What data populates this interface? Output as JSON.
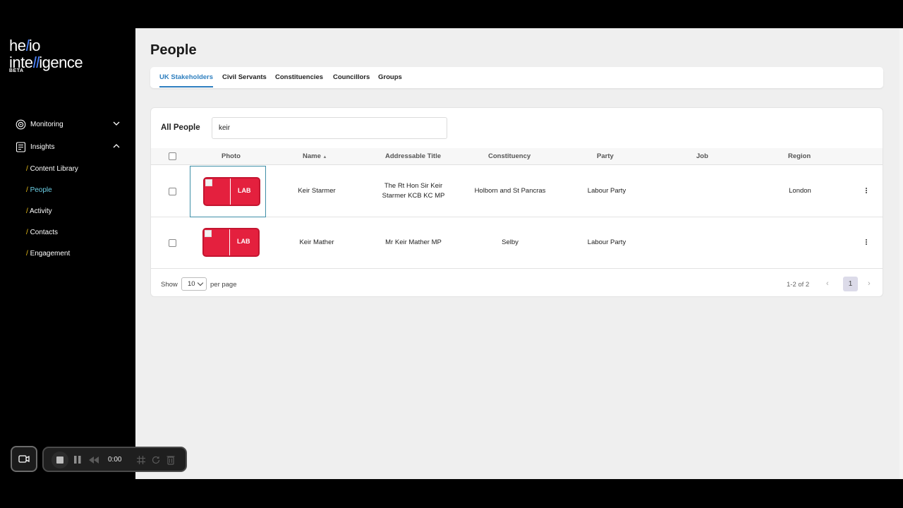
{
  "brand": {
    "line1": "he",
    "line1_accent": "l",
    "line1_end": "io",
    "line2": "inte",
    "line2_accent": "ll",
    "line2_end": "igence",
    "badge": "BETA"
  },
  "sidebar": {
    "groups": [
      {
        "label": "Monitoring",
        "icon": "monitoring-icon",
        "expanded": false
      },
      {
        "label": "Insights",
        "icon": "insights-icon",
        "expanded": true
      }
    ],
    "insights_items": [
      {
        "label": "Content Library",
        "active": false
      },
      {
        "label": "People",
        "active": true
      },
      {
        "label": "Activity",
        "active": false
      },
      {
        "label": "Contacts",
        "active": false
      },
      {
        "label": "Engagement",
        "active": false
      }
    ],
    "slash": "/"
  },
  "page": {
    "title": "People"
  },
  "tabs": [
    {
      "label": "UK Stakeholders",
      "active": true
    },
    {
      "label": "Civil Servants",
      "active": false
    },
    {
      "label": "Constituencies",
      "active": false
    },
    {
      "label": "Councillors",
      "active": false
    },
    {
      "label": "Groups",
      "active": false
    }
  ],
  "table": {
    "heading": "All People",
    "search_value": "keir",
    "columns": [
      "Photo",
      "Name",
      "Addressable Title",
      "Constituency",
      "Party",
      "Job",
      "Region"
    ],
    "sort_indicator": "▲",
    "rows": [
      {
        "party_badge": "LAB",
        "name": "Keir Starmer",
        "title_line1": "The Rt Hon Sir Keir",
        "title_line2": "Starmer KCB KC MP",
        "constituency": "Holborn and St Pancras",
        "party": "Labour Party",
        "job": "",
        "region": "London"
      },
      {
        "party_badge": "LAB",
        "name": "Keir Mather",
        "title_line1": "Mr Keir Mather MP",
        "title_line2": "",
        "constituency": "Selby",
        "party": "Labour Party",
        "job": "",
        "region": ""
      }
    ]
  },
  "pagination": {
    "show": "Show",
    "per_page_value": "10",
    "per_page": "per page",
    "range": "1-2 of 2",
    "prev": "‹",
    "current": "1",
    "next": "›"
  },
  "recorder": {
    "time": "0:00"
  },
  "colors": {
    "accent_tab": "#2e7fbf",
    "party_lab": "#e4203e",
    "active_nav": "#6cd0e6"
  }
}
